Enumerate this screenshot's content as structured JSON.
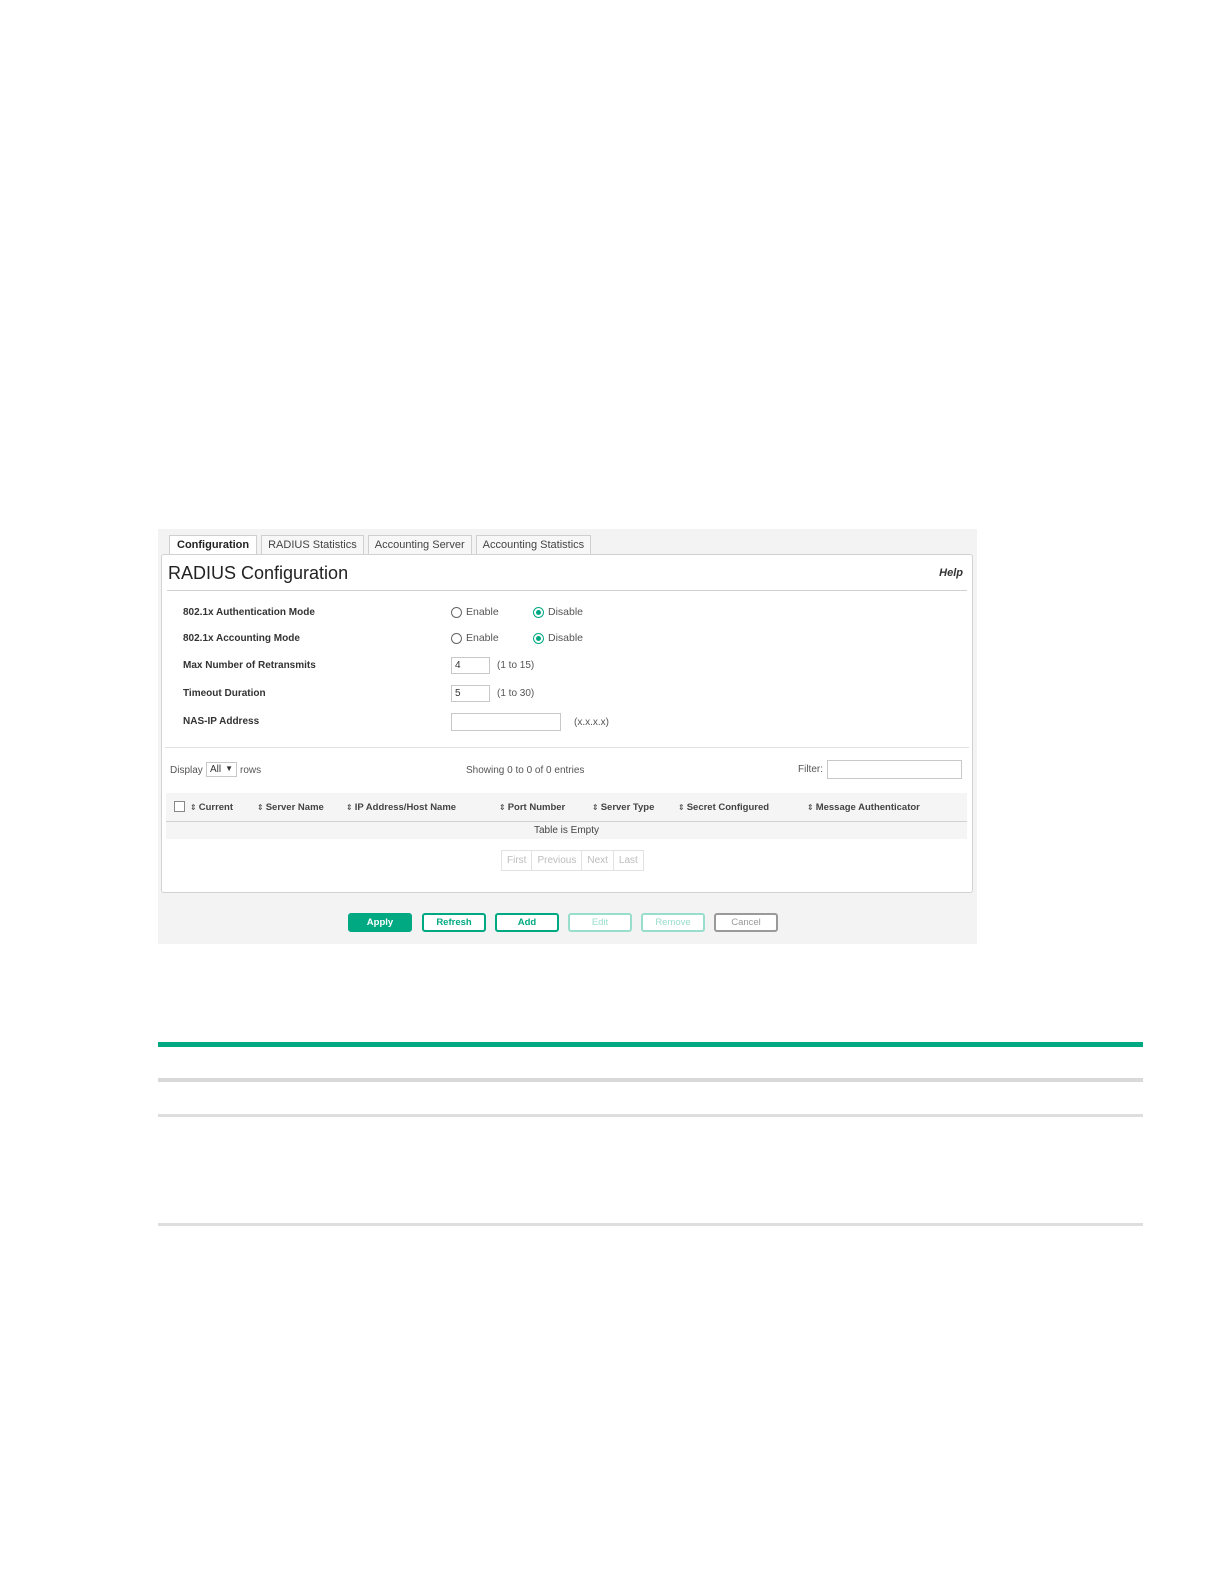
{
  "tabs": [
    "Configuration",
    "RADIUS Statistics",
    "Accounting Server",
    "Accounting Statistics"
  ],
  "panel": {
    "title": "RADIUS Configuration",
    "help": "Help"
  },
  "settings": {
    "auth_mode": {
      "label": "802.1x Authentication Mode",
      "enable": "Enable",
      "disable": "Disable",
      "selected": "Disable"
    },
    "acct_mode": {
      "label": "802.1x Accounting Mode",
      "enable": "Enable",
      "disable": "Disable",
      "selected": "Disable"
    },
    "retransmits": {
      "label": "Max Number of Retransmits",
      "value": "4",
      "hint": "(1 to 15)"
    },
    "timeout": {
      "label": "Timeout Duration",
      "value": "5",
      "hint": "(1 to 30)"
    },
    "nas_ip": {
      "label": "NAS-IP Address",
      "value": "",
      "hint": "(x.x.x.x)"
    }
  },
  "table_controls": {
    "display_label": "Display",
    "display_value": "All",
    "rows_label": "rows",
    "showing": "Showing 0 to 0 of 0 entries",
    "filter_label": "Filter:"
  },
  "table": {
    "columns": [
      "Current",
      "Server Name",
      "IP Address/Host Name",
      "Port Number",
      "Server Type",
      "Secret Configured",
      "Message Authenticator"
    ],
    "empty_text": "Table is Empty"
  },
  "pager": [
    "First",
    "Previous",
    "Next",
    "Last"
  ],
  "buttons": [
    "Apply",
    "Refresh",
    "Add",
    "Edit",
    "Remove",
    "Cancel"
  ],
  "colors": {
    "accent": "#01a982",
    "rule_gray": "#d9d9d9"
  },
  "icons": {
    "sort": "sort-icon",
    "dropdown": "caret-down-icon"
  }
}
